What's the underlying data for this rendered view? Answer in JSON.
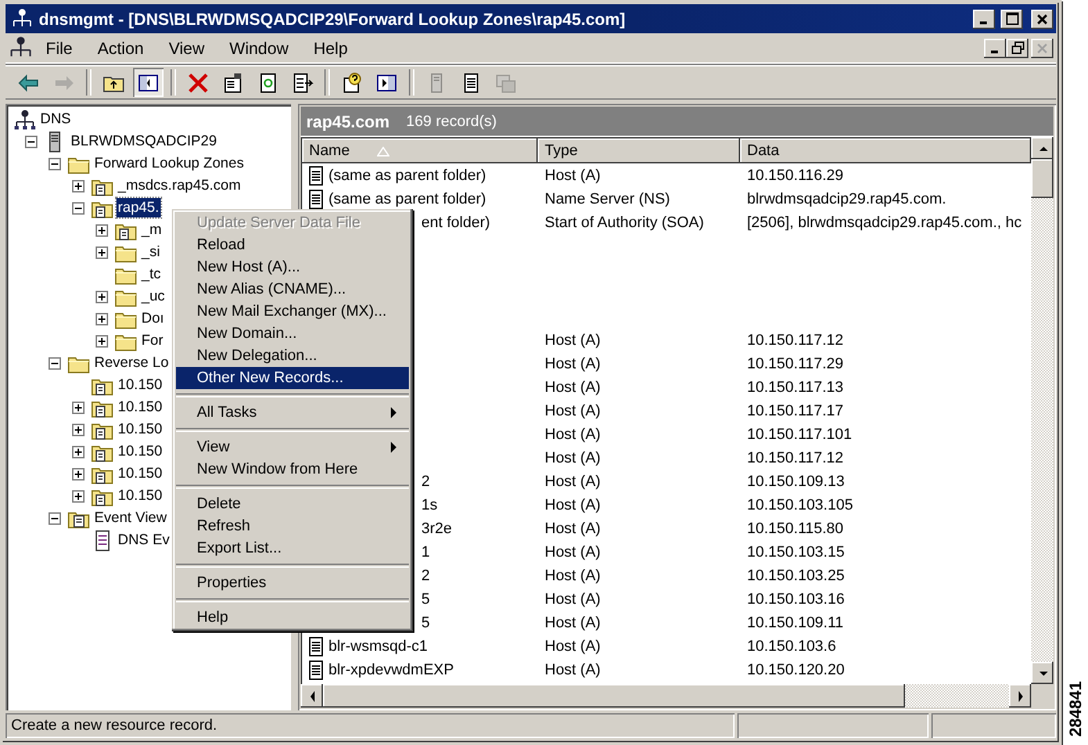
{
  "window": {
    "title": "dnsmgmt - [DNS\\BLRWDMSQADCIP29\\Forward Lookup Zones\\rap45.com]"
  },
  "menu_bar": [
    "File",
    "Action",
    "View",
    "Window",
    "Help"
  ],
  "toolbar": [
    {
      "kind": "back",
      "disabled": false,
      "pressed": false
    },
    {
      "kind": "forward",
      "disabled": true,
      "pressed": false
    },
    {
      "kind": "separator"
    },
    {
      "kind": "up",
      "disabled": false,
      "pressed": false
    },
    {
      "kind": "tree",
      "disabled": false,
      "pressed": true
    },
    {
      "kind": "separator"
    },
    {
      "kind": "delete",
      "disabled": false,
      "pressed": false
    },
    {
      "kind": "properties",
      "disabled": false,
      "pressed": false
    },
    {
      "kind": "refresh",
      "disabled": false,
      "pressed": false
    },
    {
      "kind": "export",
      "disabled": false,
      "pressed": false
    },
    {
      "kind": "separator"
    },
    {
      "kind": "help",
      "disabled": false,
      "pressed": false
    },
    {
      "kind": "pane",
      "disabled": false,
      "pressed": false
    },
    {
      "kind": "separator"
    },
    {
      "kind": "server",
      "disabled": true,
      "pressed": false
    },
    {
      "kind": "notepad",
      "disabled": false,
      "pressed": false
    },
    {
      "kind": "copy",
      "disabled": true,
      "pressed": false
    }
  ],
  "tree": [
    {
      "label": "DNS",
      "kind": "dns",
      "selected": false,
      "children": [
        {
          "label": "BLRWDMSQADCIP29",
          "kind": "server",
          "expanded": true,
          "selected": false,
          "children": [
            {
              "label": "Forward Lookup Zones",
              "kind": "folder",
              "expanded": true,
              "selected": false,
              "children": [
                {
                  "label": "_msdcs.rap45.com",
                  "kind": "zone",
                  "expanded": false,
                  "selected": false
                },
                {
                  "label": "rap45.",
                  "kind": "zone",
                  "expanded": true,
                  "selected": true,
                  "children": [
                    {
                      "label": "_m",
                      "kind": "zone",
                      "expanded": false,
                      "selected": false
                    },
                    {
                      "label": "_si",
                      "kind": "folder",
                      "expanded": false,
                      "selected": false
                    },
                    {
                      "label": "_tc",
                      "kind": "folder",
                      "selected": false
                    },
                    {
                      "label": "_uc",
                      "kind": "folder",
                      "expanded": false,
                      "selected": false
                    },
                    {
                      "label": "Doı",
                      "kind": "folder",
                      "expanded": false,
                      "selected": false
                    },
                    {
                      "label": "For",
                      "kind": "folder",
                      "expanded": false,
                      "selected": false
                    }
                  ]
                }
              ]
            },
            {
              "label": "Reverse Lo",
              "kind": "folder",
              "expanded": true,
              "selected": false,
              "children": [
                {
                  "label": "10.150",
                  "kind": "zone",
                  "selected": false
                },
                {
                  "label": "10.150",
                  "kind": "zone",
                  "expanded": false,
                  "selected": false
                },
                {
                  "label": "10.150",
                  "kind": "zone",
                  "expanded": false,
                  "selected": false
                },
                {
                  "label": "10.150",
                  "kind": "zone",
                  "expanded": false,
                  "selected": false
                },
                {
                  "label": "10.150",
                  "kind": "zone",
                  "expanded": false,
                  "selected": false
                },
                {
                  "label": "10.150",
                  "kind": "zone",
                  "expanded": false,
                  "selected": false
                }
              ]
            },
            {
              "label": "Event View",
              "kind": "event",
              "expanded": true,
              "selected": false,
              "children": [
                {
                  "label": "DNS Ev",
                  "kind": "log",
                  "selected": false
                }
              ]
            }
          ]
        }
      ]
    }
  ],
  "result": {
    "title": "rap45.com",
    "count": "169 record(s)",
    "columns": [
      "Name",
      "Type",
      "Data"
    ],
    "rows": [
      {
        "kind": "record",
        "name": "(same as parent folder)",
        "type": "Host (A)",
        "data": "10.150.116.29"
      },
      {
        "kind": "record",
        "name": "(same as parent folder)",
        "type": "Name Server (NS)",
        "data": "blrwdmsqadcip29.rap45.com."
      },
      {
        "kind": "covered",
        "name": "ent folder)",
        "type": "Start of Authority (SOA)",
        "data": "[2506], blrwdmsqadcip29.rap45.com., hc"
      },
      {
        "kind": "blank"
      },
      {
        "kind": "blank"
      },
      {
        "kind": "blank"
      },
      {
        "kind": "blank"
      },
      {
        "kind": "covered",
        "type": "Host (A)",
        "data": "10.150.117.12"
      },
      {
        "kind": "covered",
        "type": "Host (A)",
        "data": "10.150.117.29"
      },
      {
        "kind": "covered",
        "type": "Host (A)",
        "data": "10.150.117.13"
      },
      {
        "kind": "covered",
        "type": "Host (A)",
        "data": "10.150.117.17"
      },
      {
        "kind": "covered",
        "type": "Host (A)",
        "data": "10.150.117.101"
      },
      {
        "kind": "covered",
        "type": "Host (A)",
        "data": "10.150.117.12"
      },
      {
        "kind": "covered",
        "name": "2",
        "type": "Host (A)",
        "data": "10.150.109.13"
      },
      {
        "kind": "covered",
        "name": "1s",
        "type": "Host (A)",
        "data": "10.150.103.105"
      },
      {
        "kind": "covered",
        "name": "3r2e",
        "type": "Host (A)",
        "data": "10.150.115.80"
      },
      {
        "kind": "covered",
        "name": "1",
        "type": "Host (A)",
        "data": "10.150.103.15"
      },
      {
        "kind": "covered",
        "name": "2",
        "type": "Host (A)",
        "data": "10.150.103.25"
      },
      {
        "kind": "covered",
        "name": "5",
        "type": "Host (A)",
        "data": "10.150.103.16"
      },
      {
        "kind": "covered",
        "name": "5",
        "type": "Host (A)",
        "data": "10.150.109.11"
      },
      {
        "kind": "record",
        "name": "blr-wsmsqd-c1",
        "type": "Host (A)",
        "data": "10.150.103.6"
      },
      {
        "kind": "record",
        "name": "blr-xpdevwdmEXP",
        "type": "Host (A)",
        "data": "10.150.120.20"
      }
    ]
  },
  "context_menu": [
    {
      "kind": "item",
      "label": "Update Server Data File",
      "disabled": true,
      "selected": false
    },
    {
      "kind": "item",
      "label": "Reload",
      "disabled": false,
      "selected": false
    },
    {
      "kind": "item",
      "label": "New Host (A)...",
      "disabled": false,
      "selected": false
    },
    {
      "kind": "item",
      "label": "New Alias (CNAME)...",
      "disabled": false,
      "selected": false
    },
    {
      "kind": "item",
      "label": "New Mail Exchanger (MX)...",
      "disabled": false,
      "selected": false
    },
    {
      "kind": "item",
      "label": "New Domain...",
      "disabled": false,
      "selected": false
    },
    {
      "kind": "item",
      "label": "New Delegation...",
      "disabled": false,
      "selected": false
    },
    {
      "kind": "item",
      "label": "Other New Records...",
      "disabled": false,
      "selected": true
    },
    {
      "kind": "separator"
    },
    {
      "kind": "submenu",
      "label": "All Tasks",
      "disabled": false,
      "selected": false
    },
    {
      "kind": "separator"
    },
    {
      "kind": "submenu",
      "label": "View",
      "disabled": false,
      "selected": false
    },
    {
      "kind": "item",
      "label": "New Window from Here",
      "disabled": false,
      "selected": false
    },
    {
      "kind": "separator"
    },
    {
      "kind": "item",
      "label": "Delete",
      "disabled": false,
      "selected": false
    },
    {
      "kind": "item",
      "label": "Refresh",
      "disabled": false,
      "selected": false
    },
    {
      "kind": "item",
      "label": "Export List...",
      "disabled": false,
      "selected": false
    },
    {
      "kind": "separator"
    },
    {
      "kind": "item",
      "label": "Properties",
      "disabled": false,
      "selected": false
    },
    {
      "kind": "separator"
    },
    {
      "kind": "item",
      "label": "Help",
      "disabled": false,
      "selected": false
    }
  ],
  "status_bar": {
    "text": "Create a new resource record."
  },
  "figure_number": "284841"
}
